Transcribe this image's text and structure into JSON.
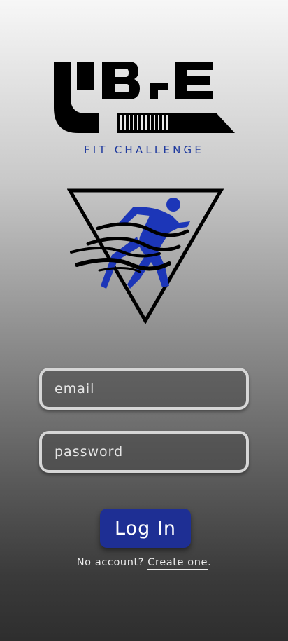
{
  "brand": {
    "logo_text": "VIBE",
    "tagline": "FIT CHALLENGE",
    "accent_color": "#1e2f94",
    "emblem": "running-man-emblem"
  },
  "form": {
    "email_placeholder": "email",
    "password_placeholder": "password",
    "login_label": "Log In"
  },
  "signup": {
    "prompt": "No account? ",
    "link_label": "Create one",
    "suffix": "."
  }
}
